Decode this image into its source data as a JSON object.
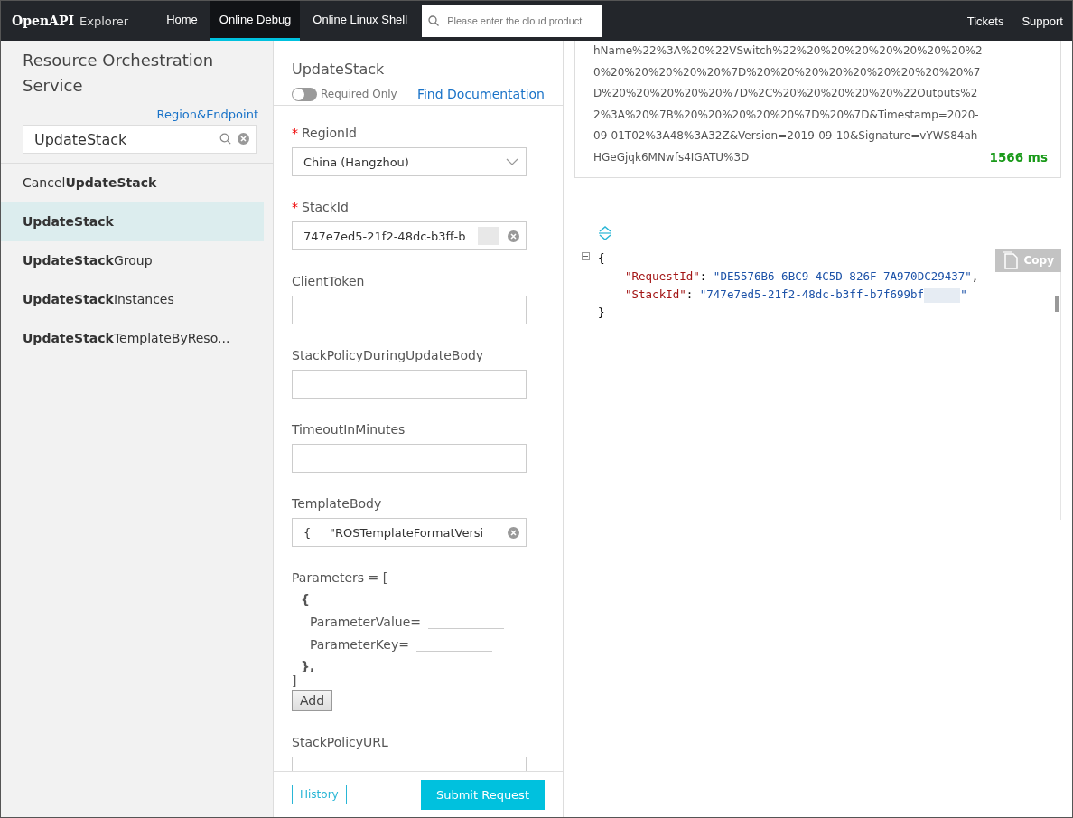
{
  "nav": {
    "brand": "OpenAPI",
    "brand_suffix": "Explorer",
    "tabs": [
      {
        "label": "Home",
        "selected": false
      },
      {
        "label": "Online Debug",
        "selected": true
      },
      {
        "label": "Online Linux Shell",
        "selected": false
      }
    ],
    "search": {
      "placeholder": "Please enter the cloud product"
    },
    "links": [
      "Tickets",
      "Support"
    ]
  },
  "sidebar": {
    "title": "Resource Orchestration Service",
    "region_link": "Region&Endpoint",
    "search": {
      "value": "UpdateStack"
    },
    "items": [
      {
        "label": "Cancel**UpdateStack**",
        "selected": false
      },
      {
        "label": "**UpdateStack**",
        "selected": true
      },
      {
        "label": "**UpdateStack**Group",
        "selected": false
      },
      {
        "label": "**UpdateStack**Instances",
        "selected": false
      },
      {
        "label": "**UpdateStack**TemplateByReso...",
        "selected": false
      }
    ]
  },
  "form": {
    "title": "UpdateStack",
    "required_mark": "*",
    "required_only": {
      "label": "Required Only",
      "on": false
    },
    "doc_link": "Find Documentation",
    "fields": [
      {
        "kind": "select",
        "label": "RegionId",
        "required": true,
        "value": "China (Hangzhou)"
      },
      {
        "kind": "text",
        "label": "StackId",
        "required": true,
        "value": "747e7ed5-21f2-48dc-b3ff-b",
        "masked": true,
        "clearable": true
      },
      {
        "kind": "text",
        "label": "ClientToken",
        "required": false
      },
      {
        "kind": "text",
        "label": "StackPolicyDuringUpdateBody",
        "required": false
      },
      {
        "kind": "text",
        "label": "TimeoutInMinutes",
        "required": false
      },
      {
        "kind": "text",
        "label": "TemplateBody",
        "required": false,
        "value": "{     \"ROSTemplateFormatVersi",
        "clearable": true
      },
      {
        "kind": "params",
        "label": "Parameters = [",
        "open": "{",
        "entries": [
          "ParameterValue=",
          "ParameterKey="
        ],
        "close": "},",
        "end": "]",
        "add_button": "Add"
      },
      {
        "kind": "text",
        "label": "StackPolicyURL",
        "required": false
      }
    ],
    "history_button": "History",
    "submit_button": "Submit Request"
  },
  "result": {
    "request_url": [
      "hName%22%3A%20%22VSwitch%22%20%20%20%20%20%20%20%2",
      "0%20%20%20%20%20%7D%20%20%20%20%20%20%20%20%20%7",
      "D%20%20%20%20%20%7D%2C%20%20%20%20%20%22Outputs%2",
      "2%3A%20%7B%20%20%20%20%20%7D%20%7D&Timestamp=2020-",
      "09-01T02%3A48%3A32Z&Version=2019-09-10&Signature=vYWS84ah",
      "HGeGjqk6MNwfs4IGATU%3D"
    ],
    "response_time": "1566 ms",
    "copy_button": "Copy",
    "json_open": "{",
    "json_lines": [
      {
        "key": "\"RequestId\"",
        "sep": ": ",
        "value": "\"DE5576B6-6BC9-4C5D-826F-7A970DC29437\"",
        "end": ",",
        "masked": false
      },
      {
        "key": "\"StackId\"",
        "sep": ": ",
        "value": "\"747e7ed5-21f2-48dc-b3ff-b7f699bf",
        "end": "\"",
        "masked": true
      }
    ],
    "json_close": "}"
  }
}
